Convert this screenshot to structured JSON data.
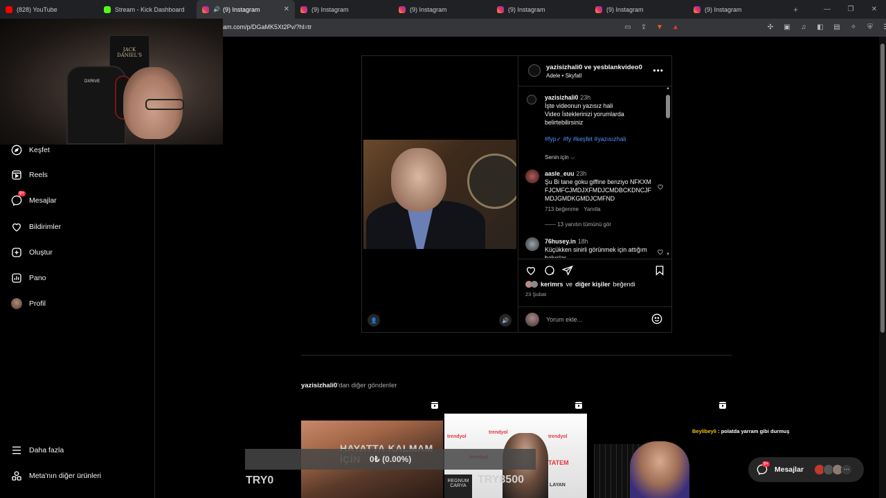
{
  "browser": {
    "tabs": [
      {
        "title": "(828) YouTube",
        "icon": "youtube-icon"
      },
      {
        "title": "Stream - Kick Dashboard",
        "icon": "kick-icon"
      },
      {
        "title": "(9) Instagram",
        "icon": "instagram-icon",
        "active": true
      },
      {
        "title": "(9) Instagram",
        "icon": "instagram-icon"
      },
      {
        "title": "(9) Instagram",
        "icon": "instagram-icon"
      },
      {
        "title": "(9) Instagram",
        "icon": "instagram-icon"
      },
      {
        "title": "(9) Instagram",
        "icon": "instagram-icon"
      },
      {
        "title": "(9) Instagram",
        "icon": "instagram-icon"
      }
    ],
    "url": "am.com/p/DGaMK5Xt2Pv/?hl=tr",
    "new_tab": "+",
    "window_controls": [
      "—",
      "❐",
      "✕"
    ]
  },
  "webcam": {
    "poster_text": "JACK DANIEL'S",
    "chair_text": "DXRIVE"
  },
  "sidebar": {
    "items": [
      {
        "label": "Keşfet",
        "icon": "explore-icon"
      },
      {
        "label": "Reels",
        "icon": "reels-icon"
      },
      {
        "label": "Mesajlar",
        "icon": "messenger-icon",
        "badge": "9+"
      },
      {
        "label": "Bildirimler",
        "icon": "heart-icon"
      },
      {
        "label": "Oluştur",
        "icon": "plus-square-icon"
      },
      {
        "label": "Pano",
        "icon": "dashboard-icon"
      },
      {
        "label": "Profil",
        "icon": "avatar"
      }
    ],
    "bottom": [
      {
        "label": "Daha fazla",
        "icon": "menu-icon"
      },
      {
        "label": "Meta'nın diğer ürünleri",
        "icon": "meta-products-icon"
      }
    ]
  },
  "post": {
    "header": {
      "users": "yazisizhali0 ve yesblankvideo0",
      "music": "Adele • Skyfall"
    },
    "caption": {
      "user": "yazisizhali0",
      "time": "23h",
      "lines": [
        "İşte videonun yazısız hali",
        "Video İsteklerinizi yorumlarda",
        "belirtebilirsiniz"
      ],
      "tags": "#fyp✓ #fy #keşfet #yazısızhali"
    },
    "sort_label": "Senin için",
    "comments": [
      {
        "user": "aasle_euu",
        "time": "23h",
        "text": "Şu Bi tane goku giffine benziyo NFKXMFJCMFCJMDJXFMDJCMDBCKDNCJFMDJGMDKGMDJCMFND",
        "likes": "713 beğenme",
        "reply": "Yanıtla",
        "view_replies": "13 yanıtın tümünü gör"
      },
      {
        "user": "76husey.in",
        "time": "18h",
        "text": "Küçükken sinirli görünmek için attığım bakışlar"
      }
    ],
    "liked_by_user": "kerimrs",
    "liked_by_rest": "ve",
    "liked_by_others": "diğer kişiler",
    "liked_by_suffix": "beğendi",
    "date": "23 Şubat",
    "comment_placeholder": "Yorum ekle..."
  },
  "more_posts": {
    "user": "yazisizhali0",
    "suffix": "'dan diğer gönderiler"
  },
  "thumbnails": [
    {
      "caption": "HAYATTA KALMAM İÇİN"
    },
    {
      "logos": [
        "trendyol",
        "trendyol",
        "trendyol",
        "trendyol",
        "trendyol"
      ],
      "banner_1": "TATEM",
      "banner_2": "REGNUM CARYA",
      "banner_3": "LAYAN"
    },
    {}
  ],
  "stream_overlay": {
    "donation_goal": "0₺ (0.00%)",
    "left_amount": "TRY0",
    "right_amount": "TRY8500",
    "chat_user": "Beylibeyli",
    "chat_sep": ":",
    "chat_text": "polatda yarram gibi durmuş"
  },
  "messages_pill": {
    "label": "Mesajlar",
    "badge": "9+",
    "more": "⋯"
  },
  "colors": {
    "accent": "#4f8ff7",
    "badge": "#ff3040",
    "background": "#000000",
    "border": "#262626"
  }
}
